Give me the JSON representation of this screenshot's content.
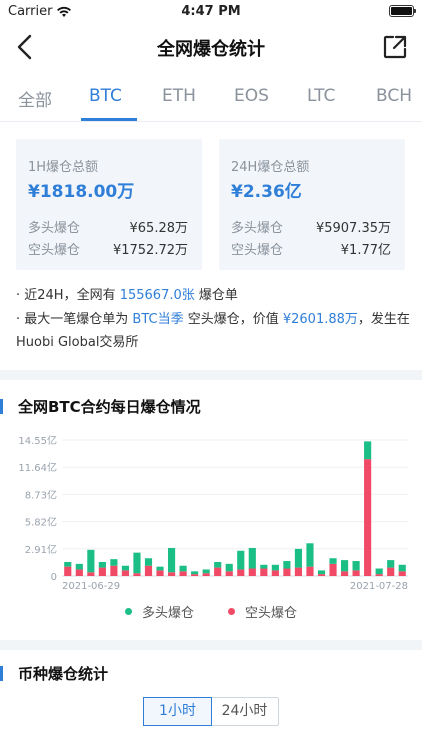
{
  "status": {
    "carrier": "Carrier",
    "time": "4:47 PM"
  },
  "nav": {
    "title": "全网爆仓统计"
  },
  "tabs": [
    "全部",
    "BTC",
    "ETH",
    "EOS",
    "LTC",
    "BCH"
  ],
  "active_tab": "BTC",
  "cards": [
    {
      "label": "1H爆仓总额",
      "total": "¥1818.00万",
      "long_label": "多头爆仓",
      "long_value": "¥65.28万",
      "short_label": "空头爆仓",
      "short_value": "¥1752.72万"
    },
    {
      "label": "24H爆仓总额",
      "total": "¥2.36亿",
      "long_label": "多头爆仓",
      "long_value": "¥5907.35万",
      "short_label": "空头爆仓",
      "short_value": "¥1.77亿"
    }
  ],
  "info": {
    "line1_prefix": "· 近24H，全网有 ",
    "line1_count": "155667.0张",
    "line1_suffix": " 爆仓单",
    "line2_prefix": "· 最大一笔爆仓单为 ",
    "line2_contract": "BTC当季",
    "line2_mid": " 空头爆仓，价值 ",
    "line2_value": "¥2601.88万",
    "line2_suffix": "，发生在Huobi Global交易所"
  },
  "section_chart_title": "全网BTC合约每日爆仓情况",
  "section_coin_title": "币种爆仓统计",
  "segments": [
    "1小时",
    "24小时"
  ],
  "active_segment": "1小时",
  "colors": {
    "accent": "#2f7ed8",
    "long": "#1bbf85",
    "short": "#f04a66"
  },
  "chart_data": {
    "type": "bar",
    "stacked": true,
    "y_ticks": [
      "0",
      "2.91亿",
      "5.82亿",
      "8.73亿",
      "11.64亿",
      "14.55亿"
    ],
    "ylim": [
      0,
      14.55
    ],
    "x_tick_labels": [
      "2021-06-29",
      "2021-07-28"
    ],
    "series": [
      {
        "name": "多头爆仓",
        "values": [
          0.5,
          0.6,
          2.4,
          0.6,
          0.7,
          0.5,
          2.2,
          0.8,
          0.4,
          2.6,
          0.6,
          0.3,
          0.4,
          0.6,
          0.8,
          2.0,
          2.2,
          0.4,
          0.6,
          0.8,
          2.0,
          2.5,
          0.4,
          0.6,
          1.2,
          1.0,
          1.9,
          0.6,
          0.8,
          0.7
        ]
      },
      {
        "name": "空头爆仓",
        "values": [
          1.0,
          0.7,
          0.4,
          0.9,
          1.1,
          0.6,
          0.3,
          1.1,
          0.6,
          0.4,
          0.5,
          0.2,
          0.3,
          0.9,
          0.5,
          0.7,
          0.8,
          0.8,
          0.6,
          0.8,
          0.9,
          1.0,
          0.2,
          1.3,
          0.5,
          0.6,
          12.5,
          0.2,
          0.9,
          0.5
        ]
      }
    ]
  }
}
